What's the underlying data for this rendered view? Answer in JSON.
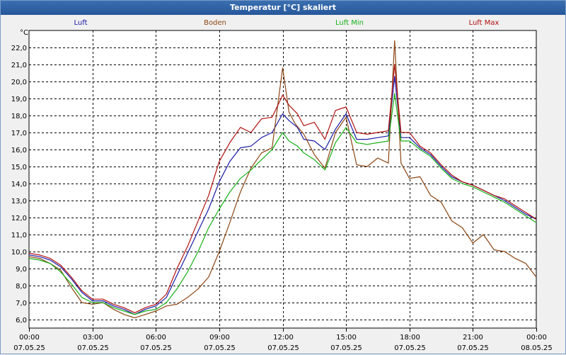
{
  "window": {
    "title": "Temperatur [°C] skaliert"
  },
  "colors": {
    "background": "#f0f0f0",
    "plot_background": "#ffffff",
    "grid": "#000000",
    "titlebar": "#2d62a8"
  },
  "chart_data": {
    "type": "line",
    "title": "Temperatur [°C] skaliert",
    "ylabel": "°C",
    "ylim": [
      5.5,
      23.0
    ],
    "yticks": [
      6.0,
      7.0,
      8.0,
      9.0,
      10.0,
      11.0,
      12.0,
      13.0,
      14.0,
      15.0,
      16.0,
      17.0,
      18.0,
      19.0,
      20.0,
      21.0,
      22.0
    ],
    "ytick_labels": [
      "6,0",
      "7,0",
      "8,0",
      "9,0",
      "10,0",
      "11,0",
      "12,0",
      "13,0",
      "14,0",
      "15,0",
      "16,0",
      "17,0",
      "18,0",
      "19,0",
      "20,0",
      "21,0",
      "22,0"
    ],
    "xlim": [
      0,
      24
    ],
    "xticks": [
      {
        "time": "00:00",
        "date": "07.05.25",
        "h": 0
      },
      {
        "time": "03:00",
        "date": "07.05.25",
        "h": 3
      },
      {
        "time": "06:00",
        "date": "07.05.25",
        "h": 6
      },
      {
        "time": "09:00",
        "date": "07.05.25",
        "h": 9
      },
      {
        "time": "12:00",
        "date": "07.05.25",
        "h": 12
      },
      {
        "time": "15:00",
        "date": "07.05.25",
        "h": 15
      },
      {
        "time": "18:00",
        "date": "07.05.25",
        "h": 18
      },
      {
        "time": "21:00",
        "date": "07.05.25",
        "h": 21
      },
      {
        "time": "00:00",
        "date": "08.05.25",
        "h": 24
      }
    ],
    "grid": true,
    "legend_position": "top",
    "series": [
      {
        "name": "Luft",
        "color": "#1a1aa8",
        "points": [
          [
            0,
            9.8
          ],
          [
            0.5,
            9.7
          ],
          [
            1,
            9.5
          ],
          [
            1.5,
            9.1
          ],
          [
            2,
            8.4
          ],
          [
            2.5,
            7.6
          ],
          [
            3,
            7.1
          ],
          [
            3.5,
            7.1
          ],
          [
            4,
            6.8
          ],
          [
            4.5,
            6.6
          ],
          [
            5,
            6.3
          ],
          [
            5.5,
            6.6
          ],
          [
            6,
            6.8
          ],
          [
            6.5,
            7.3
          ],
          [
            7,
            8.6
          ],
          [
            7.5,
            9.9
          ],
          [
            8,
            11.2
          ],
          [
            8.5,
            12.5
          ],
          [
            9,
            14.1
          ],
          [
            9.5,
            15.3
          ],
          [
            10,
            16.1
          ],
          [
            10.5,
            16.2
          ],
          [
            11,
            16.7
          ],
          [
            11.5,
            17.0
          ],
          [
            12,
            18.1
          ],
          [
            12.3,
            17.7
          ],
          [
            12.7,
            17.3
          ],
          [
            13,
            16.6
          ],
          [
            13.5,
            16.5
          ],
          [
            14,
            16.0
          ],
          [
            14.5,
            17.2
          ],
          [
            15,
            18.1
          ],
          [
            15.5,
            16.6
          ],
          [
            16,
            16.6
          ],
          [
            16.5,
            16.7
          ],
          [
            17,
            16.8
          ],
          [
            17.3,
            20.3
          ],
          [
            17.6,
            16.7
          ],
          [
            18,
            16.7
          ],
          [
            18.5,
            16.1
          ],
          [
            19,
            15.7
          ],
          [
            19.5,
            15.0
          ],
          [
            20,
            14.4
          ],
          [
            20.5,
            14.1
          ],
          [
            21,
            13.9
          ],
          [
            21.5,
            13.6
          ],
          [
            22,
            13.3
          ],
          [
            22.5,
            13.0
          ],
          [
            23,
            12.6
          ],
          [
            23.5,
            12.2
          ],
          [
            24,
            11.9
          ]
        ]
      },
      {
        "name": "Boden",
        "color": "#8b4513",
        "points": [
          [
            0,
            9.7
          ],
          [
            0.5,
            9.6
          ],
          [
            1,
            9.3
          ],
          [
            1.5,
            8.9
          ],
          [
            2,
            7.9
          ],
          [
            2.5,
            7.0
          ],
          [
            3,
            6.9
          ],
          [
            3.5,
            7.0
          ],
          [
            4,
            6.6
          ],
          [
            4.5,
            6.3
          ],
          [
            5,
            6.1
          ],
          [
            5.5,
            6.3
          ],
          [
            6,
            6.5
          ],
          [
            6.5,
            6.8
          ],
          [
            7,
            6.9
          ],
          [
            7.5,
            7.3
          ],
          [
            8,
            7.8
          ],
          [
            8.5,
            8.5
          ],
          [
            9,
            10.0
          ],
          [
            9.5,
            11.7
          ],
          [
            10,
            13.5
          ],
          [
            10.5,
            14.9
          ],
          [
            11,
            15.8
          ],
          [
            11.5,
            16.1
          ],
          [
            12,
            20.8
          ],
          [
            12.3,
            18.2
          ],
          [
            12.6,
            17.5
          ],
          [
            13,
            16.9
          ],
          [
            13.5,
            15.7
          ],
          [
            14,
            14.9
          ],
          [
            14.5,
            17.0
          ],
          [
            15,
            17.9
          ],
          [
            15.5,
            15.1
          ],
          [
            16,
            15.0
          ],
          [
            16.5,
            15.5
          ],
          [
            17,
            15.2
          ],
          [
            17.3,
            22.4
          ],
          [
            17.6,
            15.2
          ],
          [
            18,
            14.3
          ],
          [
            18.5,
            14.4
          ],
          [
            19,
            13.3
          ],
          [
            19.5,
            12.9
          ],
          [
            20,
            11.8
          ],
          [
            20.5,
            11.4
          ],
          [
            21,
            10.5
          ],
          [
            21.5,
            11.0
          ],
          [
            22,
            10.1
          ],
          [
            22.5,
            10.0
          ],
          [
            23,
            9.6
          ],
          [
            23.5,
            9.3
          ],
          [
            24,
            8.5
          ]
        ]
      },
      {
        "name": "Luft Min",
        "color": "#18b018",
        "points": [
          [
            0,
            9.6
          ],
          [
            0.5,
            9.5
          ],
          [
            1,
            9.3
          ],
          [
            1.5,
            8.8
          ],
          [
            2,
            8.1
          ],
          [
            2.5,
            7.3
          ],
          [
            3,
            7.0
          ],
          [
            3.5,
            7.0
          ],
          [
            4,
            6.7
          ],
          [
            4.5,
            6.5
          ],
          [
            5,
            6.3
          ],
          [
            5.5,
            6.5
          ],
          [
            6,
            6.6
          ],
          [
            6.5,
            7.0
          ],
          [
            7,
            7.8
          ],
          [
            7.5,
            8.8
          ],
          [
            8,
            10.0
          ],
          [
            8.5,
            11.4
          ],
          [
            9,
            12.5
          ],
          [
            9.5,
            13.5
          ],
          [
            10,
            14.3
          ],
          [
            10.5,
            14.8
          ],
          [
            11,
            15.4
          ],
          [
            11.5,
            16.0
          ],
          [
            12,
            17.0
          ],
          [
            12.3,
            16.5
          ],
          [
            12.7,
            16.2
          ],
          [
            13,
            15.8
          ],
          [
            13.5,
            15.4
          ],
          [
            14,
            14.8
          ],
          [
            14.5,
            16.4
          ],
          [
            15,
            17.3
          ],
          [
            15.5,
            16.4
          ],
          [
            16,
            16.3
          ],
          [
            16.5,
            16.4
          ],
          [
            17,
            16.5
          ],
          [
            17.3,
            19.3
          ],
          [
            17.6,
            16.5
          ],
          [
            18,
            16.5
          ],
          [
            18.5,
            16.0
          ],
          [
            19,
            15.6
          ],
          [
            19.5,
            14.9
          ],
          [
            20,
            14.3
          ],
          [
            20.5,
            14.0
          ],
          [
            21,
            13.8
          ],
          [
            21.5,
            13.5
          ],
          [
            22,
            13.2
          ],
          [
            22.5,
            12.9
          ],
          [
            23,
            12.5
          ],
          [
            23.5,
            12.1
          ],
          [
            24,
            11.7
          ]
        ]
      },
      {
        "name": "Luft Max",
        "color": "#b01010",
        "points": [
          [
            0,
            9.9
          ],
          [
            0.5,
            9.8
          ],
          [
            1,
            9.6
          ],
          [
            1.5,
            9.2
          ],
          [
            2,
            8.5
          ],
          [
            2.5,
            7.7
          ],
          [
            3,
            7.2
          ],
          [
            3.5,
            7.2
          ],
          [
            4,
            6.9
          ],
          [
            4.5,
            6.7
          ],
          [
            5,
            6.4
          ],
          [
            5.5,
            6.7
          ],
          [
            6,
            6.9
          ],
          [
            6.5,
            7.5
          ],
          [
            7,
            9.0
          ],
          [
            7.5,
            10.3
          ],
          [
            8,
            11.8
          ],
          [
            8.5,
            13.3
          ],
          [
            9,
            15.3
          ],
          [
            9.5,
            16.4
          ],
          [
            10,
            17.3
          ],
          [
            10.5,
            17.0
          ],
          [
            11,
            17.8
          ],
          [
            11.5,
            17.9
          ],
          [
            12,
            19.2
          ],
          [
            12.3,
            18.6
          ],
          [
            12.7,
            18.1
          ],
          [
            13,
            17.4
          ],
          [
            13.5,
            17.6
          ],
          [
            14,
            16.6
          ],
          [
            14.5,
            18.3
          ],
          [
            15,
            18.5
          ],
          [
            15.5,
            17.0
          ],
          [
            16,
            16.9
          ],
          [
            16.5,
            17.0
          ],
          [
            17,
            17.1
          ],
          [
            17.3,
            21.0
          ],
          [
            17.6,
            17.0
          ],
          [
            18,
            17.0
          ],
          [
            18.5,
            16.2
          ],
          [
            19,
            15.8
          ],
          [
            19.5,
            15.1
          ],
          [
            20,
            14.5
          ],
          [
            20.5,
            14.1
          ],
          [
            21,
            13.9
          ],
          [
            21.5,
            13.6
          ],
          [
            22,
            13.3
          ],
          [
            22.5,
            13.1
          ],
          [
            23,
            12.7
          ],
          [
            23.5,
            12.3
          ],
          [
            24,
            11.9
          ]
        ]
      }
    ]
  }
}
